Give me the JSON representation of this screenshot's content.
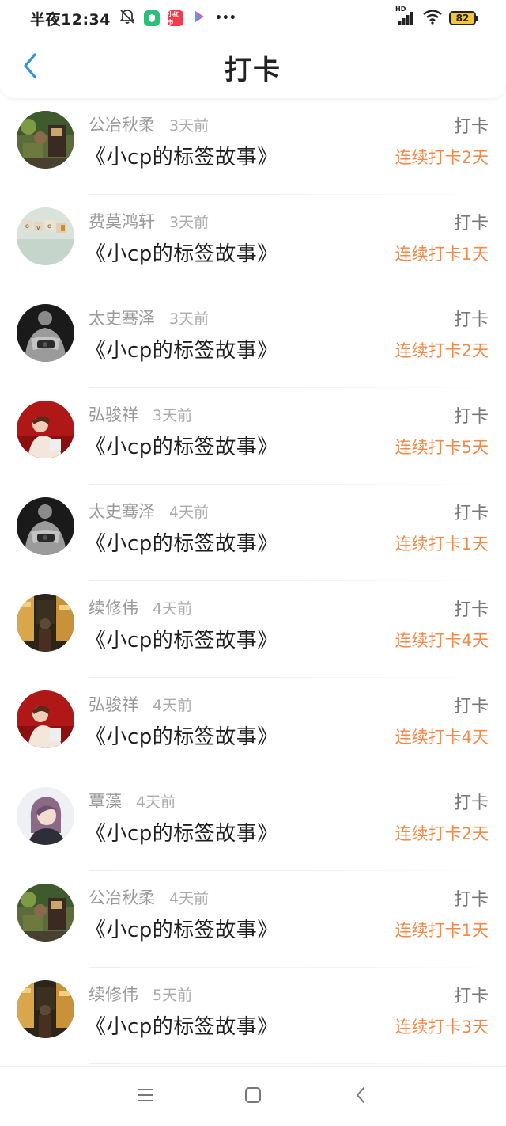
{
  "status_bar": {
    "time": "半夜12:34",
    "app_badges": [
      {
        "icon": "shield-app-icon",
        "color": "#2bbf7a",
        "text": ""
      },
      {
        "icon": "xiaohongshu-app-icon",
        "color": "#f23b4c",
        "text": "小红书"
      },
      {
        "icon": "play-app-icon",
        "color": "#ffffff",
        "text": ""
      }
    ],
    "more": "•••",
    "network": "HD",
    "battery": "82"
  },
  "header": {
    "back_icon": "chevron-left-icon",
    "title": "打卡"
  },
  "list": {
    "items": [
      {
        "user": "公冶秋柔",
        "time": "3天前",
        "story": "《小cp的标签故事》",
        "action": "打卡",
        "streak": "连续打卡2天",
        "avatar": "garden-photo"
      },
      {
        "user": "费莫鸿轩",
        "time": "3天前",
        "story": "《小cp的标签故事》",
        "action": "打卡",
        "streak": "连续打卡1天",
        "avatar": "love-blocks-photo"
      },
      {
        "user": "太史骞泽",
        "time": "3天前",
        "story": "《小cp的标签故事》",
        "action": "打卡",
        "streak": "连续打卡2天",
        "avatar": "muscle-man-photo"
      },
      {
        "user": "弘骏祥",
        "time": "3天前",
        "story": "《小cp的标签故事》",
        "action": "打卡",
        "streak": "连续打卡5天",
        "avatar": "red-portrait-photo"
      },
      {
        "user": "太史骞泽",
        "time": "4天前",
        "story": "《小cp的标签故事》",
        "action": "打卡",
        "streak": "连续打卡1天",
        "avatar": "muscle-man-photo"
      },
      {
        "user": "续修伟",
        "time": "4天前",
        "story": "《小cp的标签故事》",
        "action": "打卡",
        "streak": "连续打卡4天",
        "avatar": "night-street-photo"
      },
      {
        "user": "弘骏祥",
        "time": "4天前",
        "story": "《小cp的标签故事》",
        "action": "打卡",
        "streak": "连续打卡4天",
        "avatar": "red-portrait-photo"
      },
      {
        "user": "覃藻",
        "time": "4天前",
        "story": "《小cp的标签故事》",
        "action": "打卡",
        "streak": "连续打卡2天",
        "avatar": "girl-portrait-photo"
      },
      {
        "user": "公冶秋柔",
        "time": "4天前",
        "story": "《小cp的标签故事》",
        "action": "打卡",
        "streak": "连续打卡1天",
        "avatar": "garden-photo"
      },
      {
        "user": "续修伟",
        "time": "5天前",
        "story": "《小cp的标签故事》",
        "action": "打卡",
        "streak": "连续打卡3天",
        "avatar": "night-street-photo"
      }
    ]
  },
  "nav_bar": {
    "menu_icon": "menu-icon",
    "home_icon": "home-square-icon",
    "back_icon": "back-triangle-icon"
  },
  "colors": {
    "streak": "#f08a4b",
    "name": "#9a9a9a",
    "title": "#1e1e1e",
    "accent_back": "#2f93e0"
  }
}
